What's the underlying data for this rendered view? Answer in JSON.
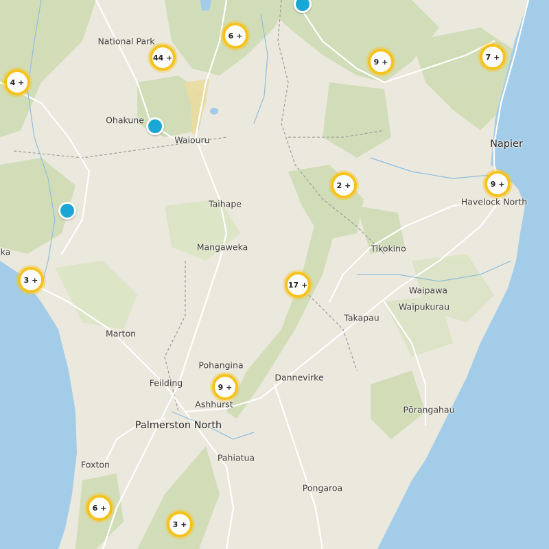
{
  "map": {
    "colors": {
      "land": "#ebe8dd",
      "forest": "#cfdcb4",
      "sea": "#a3cce9",
      "road": "#ffffff",
      "boundary": "#9a9a9a",
      "cluster_ring": "#f6c21b",
      "marker": "#1ba7d6"
    },
    "places": [
      {
        "name": "National Park"
      },
      {
        "name": "Ohakune"
      },
      {
        "name": "Waiouru"
      },
      {
        "name": "Taihape"
      },
      {
        "name": "Mangaweka"
      },
      {
        "name": "ka"
      },
      {
        "name": "Marton"
      },
      {
        "name": "Pohangina"
      },
      {
        "name": "Feilding"
      },
      {
        "name": "Ashhurst"
      },
      {
        "name": "Palmerston North"
      },
      {
        "name": "Dannevirke"
      },
      {
        "name": "Pahiatua"
      },
      {
        "name": "Foxton"
      },
      {
        "name": "Pongaroa"
      },
      {
        "name": "Pōrangahau"
      },
      {
        "name": "Takapau"
      },
      {
        "name": "Waipukurau"
      },
      {
        "name": "Waipawa"
      },
      {
        "name": "Tikokino"
      },
      {
        "name": "Havelock North"
      },
      {
        "name": "Napier"
      }
    ],
    "clusters": [
      {
        "label": "6 +"
      },
      {
        "label": "44 +"
      },
      {
        "label": "4 +"
      },
      {
        "label": "9 +"
      },
      {
        "label": "7 +"
      },
      {
        "label": "2 +"
      },
      {
        "label": "9 +"
      },
      {
        "label": "3 +"
      },
      {
        "label": "17 +"
      },
      {
        "label": "9 +"
      },
      {
        "label": "6 +"
      },
      {
        "label": "3 +"
      }
    ],
    "markers": [
      {
        "name": "marker-north"
      },
      {
        "name": "marker-ohakune"
      },
      {
        "name": "marker-west"
      }
    ]
  }
}
